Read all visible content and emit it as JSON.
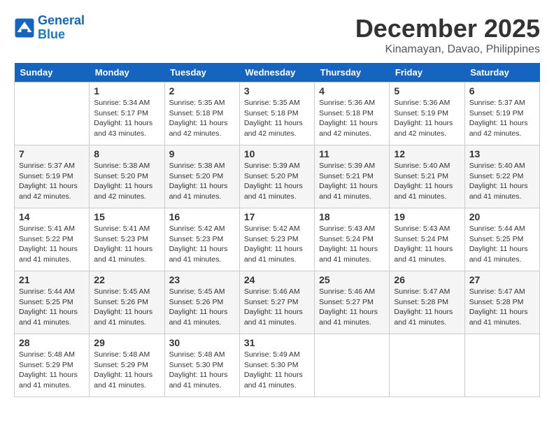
{
  "header": {
    "logo_line1": "General",
    "logo_line2": "Blue",
    "month": "December 2025",
    "location": "Kinamayan, Davao, Philippines"
  },
  "days_of_week": [
    "Sunday",
    "Monday",
    "Tuesday",
    "Wednesday",
    "Thursday",
    "Friday",
    "Saturday"
  ],
  "weeks": [
    [
      {
        "day": "",
        "info": ""
      },
      {
        "day": "1",
        "info": "Sunrise: 5:34 AM\nSunset: 5:17 PM\nDaylight: 11 hours\nand 43 minutes."
      },
      {
        "day": "2",
        "info": "Sunrise: 5:35 AM\nSunset: 5:18 PM\nDaylight: 11 hours\nand 42 minutes."
      },
      {
        "day": "3",
        "info": "Sunrise: 5:35 AM\nSunset: 5:18 PM\nDaylight: 11 hours\nand 42 minutes."
      },
      {
        "day": "4",
        "info": "Sunrise: 5:36 AM\nSunset: 5:18 PM\nDaylight: 11 hours\nand 42 minutes."
      },
      {
        "day": "5",
        "info": "Sunrise: 5:36 AM\nSunset: 5:19 PM\nDaylight: 11 hours\nand 42 minutes."
      },
      {
        "day": "6",
        "info": "Sunrise: 5:37 AM\nSunset: 5:19 PM\nDaylight: 11 hours\nand 42 minutes."
      }
    ],
    [
      {
        "day": "7",
        "info": "Sunrise: 5:37 AM\nSunset: 5:19 PM\nDaylight: 11 hours\nand 42 minutes."
      },
      {
        "day": "8",
        "info": "Sunrise: 5:38 AM\nSunset: 5:20 PM\nDaylight: 11 hours\nand 42 minutes."
      },
      {
        "day": "9",
        "info": "Sunrise: 5:38 AM\nSunset: 5:20 PM\nDaylight: 11 hours\nand 41 minutes."
      },
      {
        "day": "10",
        "info": "Sunrise: 5:39 AM\nSunset: 5:20 PM\nDaylight: 11 hours\nand 41 minutes."
      },
      {
        "day": "11",
        "info": "Sunrise: 5:39 AM\nSunset: 5:21 PM\nDaylight: 11 hours\nand 41 minutes."
      },
      {
        "day": "12",
        "info": "Sunrise: 5:40 AM\nSunset: 5:21 PM\nDaylight: 11 hours\nand 41 minutes."
      },
      {
        "day": "13",
        "info": "Sunrise: 5:40 AM\nSunset: 5:22 PM\nDaylight: 11 hours\nand 41 minutes."
      }
    ],
    [
      {
        "day": "14",
        "info": "Sunrise: 5:41 AM\nSunset: 5:22 PM\nDaylight: 11 hours\nand 41 minutes."
      },
      {
        "day": "15",
        "info": "Sunrise: 5:41 AM\nSunset: 5:23 PM\nDaylight: 11 hours\nand 41 minutes."
      },
      {
        "day": "16",
        "info": "Sunrise: 5:42 AM\nSunset: 5:23 PM\nDaylight: 11 hours\nand 41 minutes."
      },
      {
        "day": "17",
        "info": "Sunrise: 5:42 AM\nSunset: 5:23 PM\nDaylight: 11 hours\nand 41 minutes."
      },
      {
        "day": "18",
        "info": "Sunrise: 5:43 AM\nSunset: 5:24 PM\nDaylight: 11 hours\nand 41 minutes."
      },
      {
        "day": "19",
        "info": "Sunrise: 5:43 AM\nSunset: 5:24 PM\nDaylight: 11 hours\nand 41 minutes."
      },
      {
        "day": "20",
        "info": "Sunrise: 5:44 AM\nSunset: 5:25 PM\nDaylight: 11 hours\nand 41 minutes."
      }
    ],
    [
      {
        "day": "21",
        "info": "Sunrise: 5:44 AM\nSunset: 5:25 PM\nDaylight: 11 hours\nand 41 minutes."
      },
      {
        "day": "22",
        "info": "Sunrise: 5:45 AM\nSunset: 5:26 PM\nDaylight: 11 hours\nand 41 minutes."
      },
      {
        "day": "23",
        "info": "Sunrise: 5:45 AM\nSunset: 5:26 PM\nDaylight: 11 hours\nand 41 minutes."
      },
      {
        "day": "24",
        "info": "Sunrise: 5:46 AM\nSunset: 5:27 PM\nDaylight: 11 hours\nand 41 minutes."
      },
      {
        "day": "25",
        "info": "Sunrise: 5:46 AM\nSunset: 5:27 PM\nDaylight: 11 hours\nand 41 minutes."
      },
      {
        "day": "26",
        "info": "Sunrise: 5:47 AM\nSunset: 5:28 PM\nDaylight: 11 hours\nand 41 minutes."
      },
      {
        "day": "27",
        "info": "Sunrise: 5:47 AM\nSunset: 5:28 PM\nDaylight: 11 hours\nand 41 minutes."
      }
    ],
    [
      {
        "day": "28",
        "info": "Sunrise: 5:48 AM\nSunset: 5:29 PM\nDaylight: 11 hours\nand 41 minutes."
      },
      {
        "day": "29",
        "info": "Sunrise: 5:48 AM\nSunset: 5:29 PM\nDaylight: 11 hours\nand 41 minutes."
      },
      {
        "day": "30",
        "info": "Sunrise: 5:48 AM\nSunset: 5:30 PM\nDaylight: 11 hours\nand 41 minutes."
      },
      {
        "day": "31",
        "info": "Sunrise: 5:49 AM\nSunset: 5:30 PM\nDaylight: 11 hours\nand 41 minutes."
      },
      {
        "day": "",
        "info": ""
      },
      {
        "day": "",
        "info": ""
      },
      {
        "day": "",
        "info": ""
      }
    ]
  ]
}
